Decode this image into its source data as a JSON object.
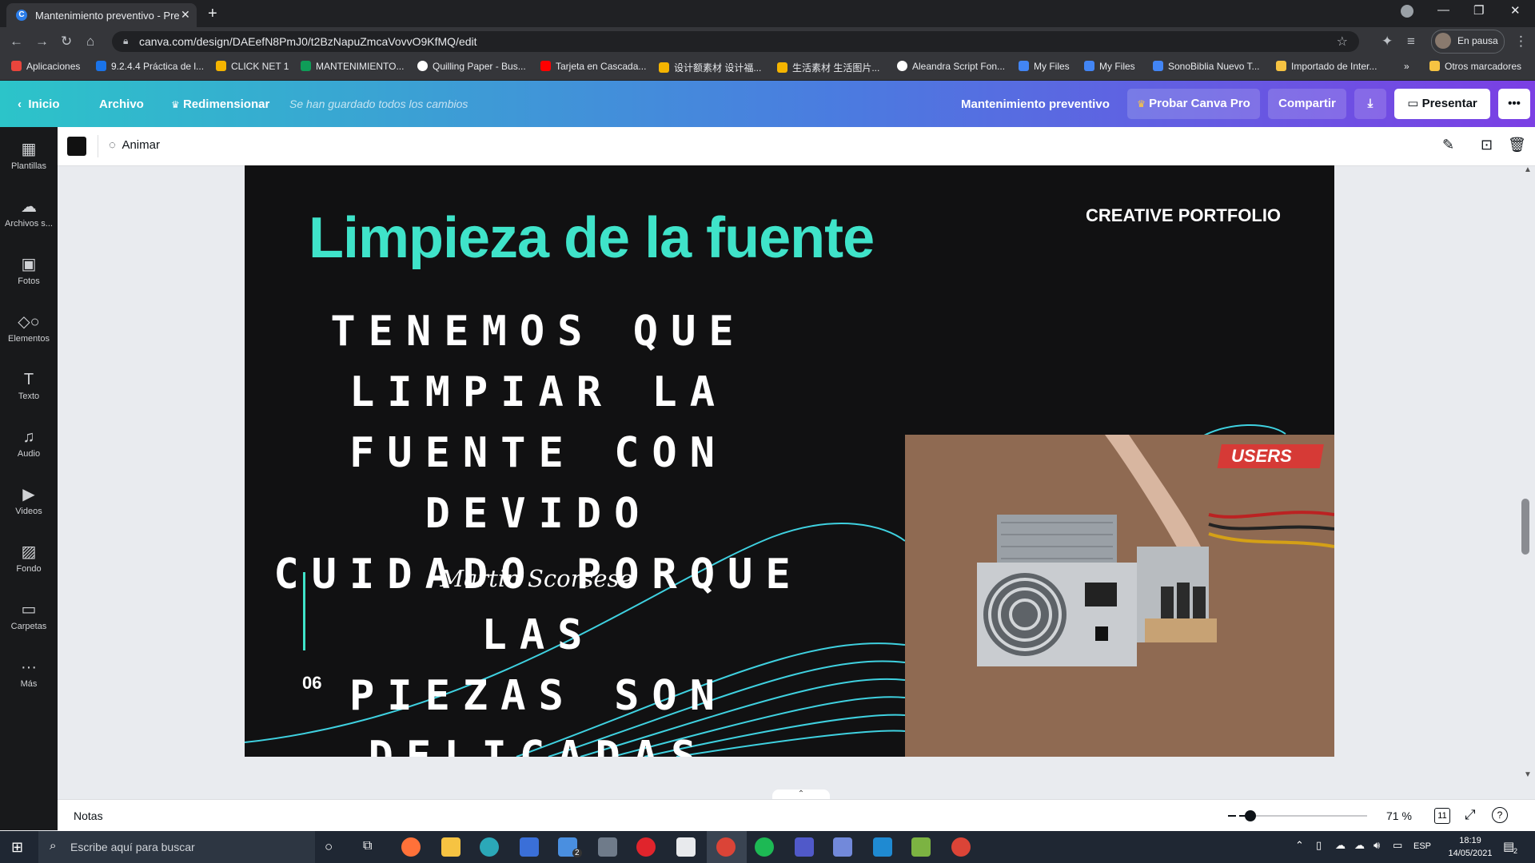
{
  "browser": {
    "tab_title": "Mantenimiento preventivo - Pre",
    "url": "canva.com/design/DAEefN8PmJ0/t2BzNapuZmcaVovvO9KfMQ/edit",
    "profile_label": "En pausa",
    "bookmarks": [
      {
        "label": "Aplicaciones",
        "color": "#e8453c"
      },
      {
        "label": "9.2.4.4 Práctica de l...",
        "color": "#1a73e8"
      },
      {
        "label": "CLICK NET 1",
        "color": "#f4b400"
      },
      {
        "label": "MANTENIMIENTO...",
        "color": "#0f9d58"
      },
      {
        "label": "Quilling Paper - Bus...",
        "color": "#ffffff"
      },
      {
        "label": "Tarjeta en Cascada...",
        "color": "#ff0000"
      },
      {
        "label": "设计额素材 设计福...",
        "color": "#f4b400"
      },
      {
        "label": "生活素材 生活图片...",
        "color": "#f4b400"
      },
      {
        "label": "Aleandra Script Fon...",
        "color": "#ffffff"
      },
      {
        "label": "My Files",
        "color": "#4285f4"
      },
      {
        "label": "My Files",
        "color": "#4285f4"
      },
      {
        "label": "SonoBiblia Nuevo T...",
        "color": "#4285f4"
      },
      {
        "label": "Importado de Inter...",
        "color": "#f6c342"
      }
    ],
    "more_bookmarks": "»",
    "other_bookmarks": "Otros marcadores"
  },
  "canva_header": {
    "home": "Inicio",
    "file": "Archivo",
    "resize": "Redimensionar",
    "saved_status": "Se han guardado todos los cambios",
    "design_name": "Mantenimiento preventivo",
    "try_pro": "Probar Canva Pro",
    "share": "Compartir",
    "present": "Presentar"
  },
  "sidebar": {
    "items": [
      {
        "label": "Plantillas",
        "icon": "templates-icon"
      },
      {
        "label": "Archivos s...",
        "icon": "upload-icon"
      },
      {
        "label": "Fotos",
        "icon": "photos-icon"
      },
      {
        "label": "Elementos",
        "icon": "elements-icon"
      },
      {
        "label": "Texto",
        "icon": "text-icon"
      },
      {
        "label": "Audio",
        "icon": "audio-icon"
      },
      {
        "label": "Videos",
        "icon": "video-icon"
      },
      {
        "label": "Fondo",
        "icon": "background-icon"
      },
      {
        "label": "Carpetas",
        "icon": "folder-icon"
      },
      {
        "label": "Más",
        "icon": "more-icon"
      }
    ]
  },
  "toolbar": {
    "animate": "Animar",
    "color_swatch": "#111111"
  },
  "slide": {
    "title": "Limpieza de la fuente",
    "portfolio": "CREATIVE PORTFOLIO",
    "body_lines": [
      "tenemos que limpiar la",
      "fuente con devido",
      "cuidado porque las",
      "piezas son delicadas"
    ],
    "author": "Martin Scorsese",
    "page_number": "06",
    "photo_watermark": "USERS",
    "accent_color": "#3fe3c9"
  },
  "bottom": {
    "notes": "Notas",
    "zoom": "71 %",
    "page_count": "11",
    "zoom_fraction": 0.09
  },
  "taskbar": {
    "search_placeholder": "Escribe aquí para buscar",
    "language": "ESP",
    "time": "18:19",
    "date": "14/05/2021",
    "mail_badge": "2",
    "notification_count": "2"
  }
}
